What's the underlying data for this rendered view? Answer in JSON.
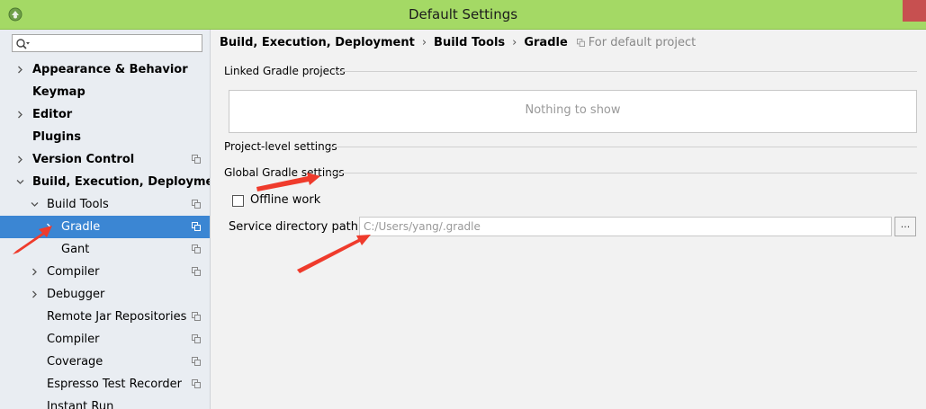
{
  "window": {
    "title": "Default Settings"
  },
  "search": {
    "placeholder": ""
  },
  "tree": [
    {
      "label": "Appearance & Behavior",
      "chevron": "right",
      "bold": true,
      "project_icon": false,
      "selected": false
    },
    {
      "label": "Keymap",
      "chevron": "none",
      "bold": true,
      "project_icon": false,
      "selected": false
    },
    {
      "label": "Editor",
      "chevron": "right",
      "bold": true,
      "project_icon": false,
      "selected": false
    },
    {
      "label": "Plugins",
      "chevron": "none",
      "bold": true,
      "project_icon": false,
      "selected": false
    },
    {
      "label": "Version Control",
      "chevron": "right",
      "bold": true,
      "project_icon": true,
      "selected": false
    },
    {
      "label": "Build, Execution, Deployment",
      "chevron": "down",
      "bold": true,
      "project_icon": false,
      "selected": false
    },
    {
      "label": "Build Tools",
      "chevron": "down",
      "bold": false,
      "project_icon": true,
      "selected": false
    },
    {
      "label": "Gradle",
      "chevron": "right",
      "bold": false,
      "project_icon": true,
      "selected": true
    },
    {
      "label": "Gant",
      "chevron": "none",
      "bold": false,
      "project_icon": true,
      "selected": false
    },
    {
      "label": "Compiler",
      "chevron": "right",
      "bold": false,
      "project_icon": true,
      "selected": false
    },
    {
      "label": "Debugger",
      "chevron": "right",
      "bold": false,
      "project_icon": false,
      "selected": false
    },
    {
      "label": "Remote Jar Repositories",
      "chevron": "none",
      "bold": false,
      "project_icon": true,
      "selected": false
    },
    {
      "label": "Compiler",
      "chevron": "none",
      "bold": false,
      "project_icon": true,
      "selected": false
    },
    {
      "label": "Coverage",
      "chevron": "none",
      "bold": false,
      "project_icon": true,
      "selected": false
    },
    {
      "label": "Espresso Test Recorder",
      "chevron": "none",
      "bold": false,
      "project_icon": true,
      "selected": false
    },
    {
      "label": "Instant Run",
      "chevron": "none",
      "bold": false,
      "project_icon": false,
      "selected": false
    }
  ],
  "breadcrumb": {
    "items": [
      "Build, Execution, Deployment",
      "Build Tools",
      "Gradle"
    ],
    "separator": "›",
    "note": "For default project"
  },
  "sections": {
    "linked": "Linked Gradle projects",
    "empty_text": "Nothing to show",
    "project_level": "Project-level settings",
    "global": "Global Gradle settings"
  },
  "offline": {
    "label": "Offline work",
    "checked": false
  },
  "service_path": {
    "label": "Service directory path:",
    "value": "C:/Users/yang/.gradle",
    "browse": "..."
  },
  "colors": {
    "titlebar": "#a4d965",
    "selection": "#3b86d3",
    "annotation": "#ef3b2c"
  }
}
